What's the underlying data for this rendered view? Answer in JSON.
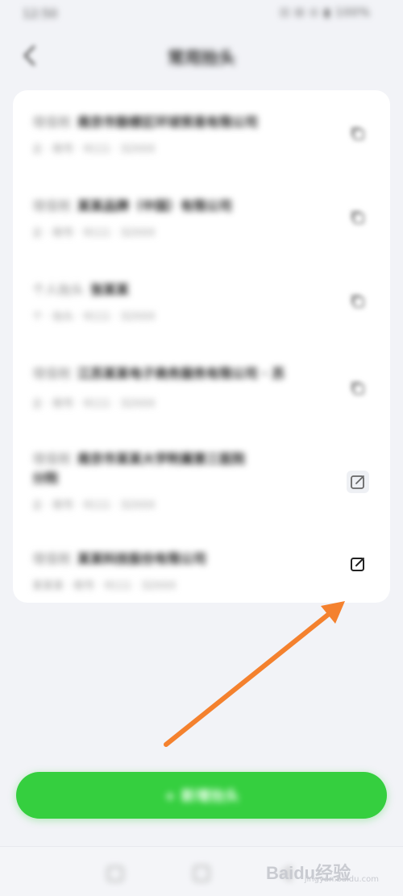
{
  "status_bar": {
    "time": "12:50",
    "icons": "⊡ ⊟ ⊙ ▮ 100%"
  },
  "header": {
    "title": "常用抬头"
  },
  "list": [
    {
      "code": "增值税",
      "name": "南京市鼓楼区环球贸易有限公司",
      "line2": "企 · 税号 · 9111 · 32XXX",
      "action": "copy-icon"
    },
    {
      "code": "增值税",
      "name": "某某品牌（中国）有限公司",
      "line2": "企 · 税号 · 9111 · 32XXX",
      "action": "copy-icon"
    },
    {
      "code": "个人抬头",
      "name": "张某某",
      "line2": "个 · 抬头 · 9111 · 32XXX",
      "action": "copy-icon"
    },
    {
      "code": "增值税",
      "name": "江苏某某电子商务服务有限公司 · 苏",
      "line2": "企 · 税号 · 9111 · 32XXX",
      "action": "copy-icon"
    },
    {
      "code": "增值税",
      "name": "南京市某某大学附属第三医院",
      "name2": "分院",
      "line2": "企 · 税号 · 9111 · 32XXX",
      "action": "edit-icon"
    },
    {
      "code": "增值税",
      "name": "某某科技股份有限公司",
      "line2": "某某某 · 税号 · 9111 · 32XXX",
      "action": "edit-icon"
    }
  ],
  "add_button": {
    "label": "+ 新增抬头"
  },
  "watermark": {
    "text": "Baidu经验",
    "sub": "jingyan.baidu.com"
  },
  "colors": {
    "accent_green": "#35cf3f",
    "arrow_orange": "#f4812e",
    "background": "#f2f3f7"
  }
}
